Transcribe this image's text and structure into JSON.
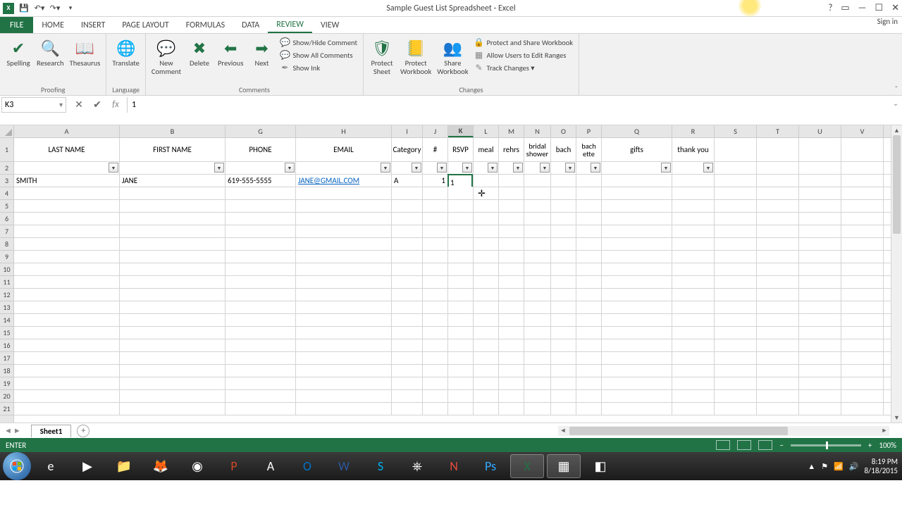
{
  "title": "Sample Guest List Spreadsheet - Excel",
  "signin": "Sign in",
  "tabs": {
    "file": "FILE",
    "home": "HOME",
    "insert": "INSERT",
    "page_layout": "PAGE LAYOUT",
    "formulas": "FORMULAS",
    "data": "DATA",
    "review": "REVIEW",
    "view": "VIEW"
  },
  "ribbon": {
    "proofing": {
      "label": "Proofing",
      "spelling": "Spelling",
      "research": "Research",
      "thesaurus": "Thesaurus"
    },
    "language": {
      "label": "Language",
      "translate": "Translate"
    },
    "comments": {
      "label": "Comments",
      "new": "New\nComment",
      "delete": "Delete",
      "previous": "Previous",
      "next": "Next",
      "showhide": "Show/Hide Comment",
      "showall": "Show All Comments",
      "showink": "Show Ink"
    },
    "changes": {
      "label": "Changes",
      "protect_sheet": "Protect\nSheet",
      "protect_wb": "Protect\nWorkbook",
      "share_wb": "Share\nWorkbook",
      "protect_share": "Protect and Share Workbook",
      "allow_edit": "Allow Users to Edit Ranges",
      "track": "Track Changes ▾"
    }
  },
  "namebox": "K3",
  "formula": "1",
  "columns": [
    "A",
    "B",
    "G",
    "H",
    "I",
    "J",
    "K",
    "L",
    "M",
    "N",
    "O",
    "P",
    "Q",
    "R",
    "S",
    "T",
    "U",
    "V"
  ],
  "selected_col": "K",
  "headers": {
    "A": "LAST NAME",
    "B": "FIRST NAME",
    "G": "PHONE",
    "H": "EMAIL",
    "I": "Category",
    "J": "#",
    "K": "RSVP",
    "L": "meal",
    "M": "rehrs",
    "N": "bridal shower",
    "O": "bach",
    "P": "bach ette",
    "Q": "gifts",
    "R": "thank you"
  },
  "data_row": {
    "A": "SMITH",
    "B": "JANE",
    "G": "619-555-5555",
    "H": "JANE@GMAIL.COM",
    "I": "A",
    "J": "1",
    "K": "1"
  },
  "sheet_tab": "Sheet1",
  "status": "ENTER",
  "zoom": "100%",
  "clock": {
    "time": "8:19 PM",
    "date": "8/18/2015"
  }
}
